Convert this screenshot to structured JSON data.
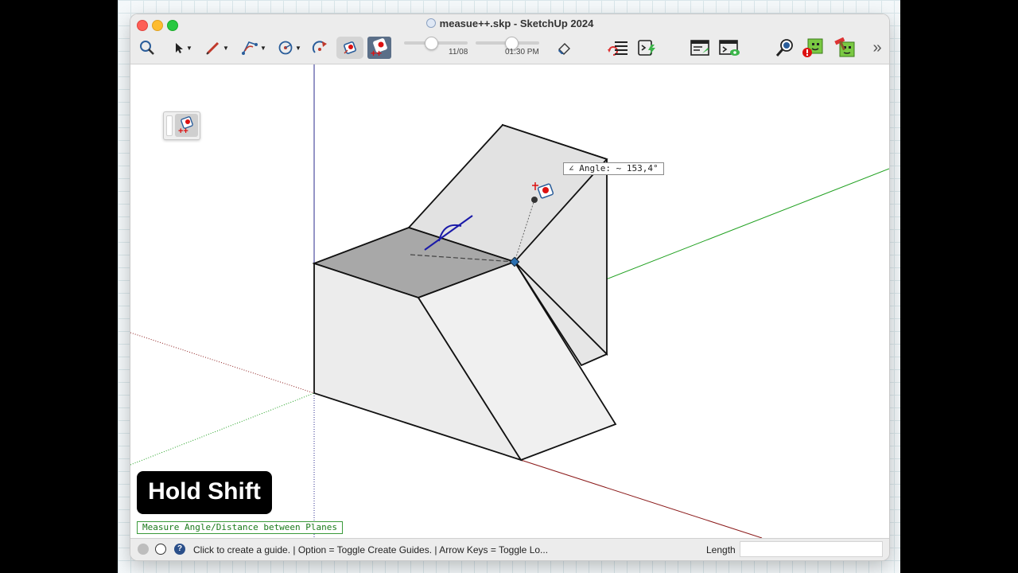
{
  "window": {
    "title": "measue++.skp - SketchUp 2024"
  },
  "toolbar": {
    "date_value": "11/08",
    "time_value": "01:30 PM",
    "date_progress": 0.42,
    "time_progress": 0.55,
    "more_label": "»"
  },
  "viewport": {
    "angle_tooltip": "∠ Angle: ~ 153,4°",
    "overlay_label": "Hold Shift",
    "tool_hint": "Measure Angle/Distance between Planes"
  },
  "statusbar": {
    "message": "Click to create a guide. | Option = Toggle Create Guides. | Arrow Keys = Toggle Lo...",
    "length_label": "Length",
    "length_value": ""
  },
  "colors": {
    "accent": "#2a6fb0",
    "axis_red": "#8b1a1a",
    "axis_green": "#1fa01f",
    "axis_blue": "#2b2b8c",
    "selected_face": "#a8a8a8"
  }
}
